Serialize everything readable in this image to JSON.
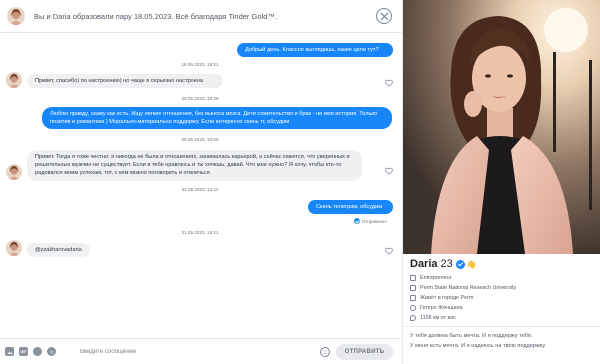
{
  "header": {
    "match_text": "Вы и Daria образовали пару 18.05.2023. Всё благодаря Tinder Gold™."
  },
  "messages": [
    {
      "dir": "out",
      "text": "Добрый день. Классно выглядишь, какие цели тут?"
    },
    {
      "dir": "ts",
      "text": "18.05.2023, 18:21"
    },
    {
      "dir": "in",
      "text": "Привет, спасибо) по настроению) но чаще я серьезно настроена"
    },
    {
      "dir": "ts",
      "text": "29.05.2023, 19:39"
    },
    {
      "dir": "out",
      "text": "Люблю правду, скажу как есть. Ищу легкие отношения, без выноса мозга. Дети сожительство и брак - не моя история. Только позитив и романтика ) Морально-материально поддержу. Если интересно скинь тг, обсудим"
    },
    {
      "dir": "ts",
      "text": "29.05.2023, 10:06"
    },
    {
      "dir": "in",
      "text": "Привет. Тогда я тоже честно: я никогда не была в отношениях, занималась карьерой, а сейчас кажется, что уверенных и решительных мужчин не существует. Если я тебе нравлюсь и ты хочешь, давай. Что мне нужно? Я хочу, чтобы кто-то радовался моим успехам, тот, с кем можно поговорить и отвлечься"
    },
    {
      "dir": "ts",
      "text": "31.05.2023, 12:11"
    },
    {
      "dir": "out",
      "text": "Скинь телеграм, обсудим"
    },
    {
      "dir": "status",
      "text": "Отправлено"
    },
    {
      "dir": "ts",
      "text": "31.05.2023, 15:21"
    },
    {
      "dir": "in",
      "text": "@zzakharovadaria"
    }
  ],
  "composer": {
    "tools": [
      "photo-icon",
      "gif-icon",
      "sticker-icon",
      "emoji-icon"
    ],
    "gif_label": "GIF",
    "placeholder": "Введите сообщение",
    "send_label": "ОТПРАВИТЬ"
  },
  "profile": {
    "name": "Daria",
    "age": "23",
    "wave": "👋",
    "details": [
      {
        "icon": "work-icon",
        "text": "Entrepreneur"
      },
      {
        "icon": "school-icon",
        "text": "Perm State National Reseach University"
      },
      {
        "icon": "home-icon",
        "text": "Живёт в городе Perm"
      },
      {
        "icon": "gender-icon",
        "text": "Гетеро Женщина"
      },
      {
        "icon": "location-icon",
        "text": "1156 км от вас"
      }
    ],
    "bio": [
      "У тебя должна быть мечта. И я поддержу тебя.",
      "У меня есть мечта. И я надеюсь на твою поддержку."
    ]
  }
}
